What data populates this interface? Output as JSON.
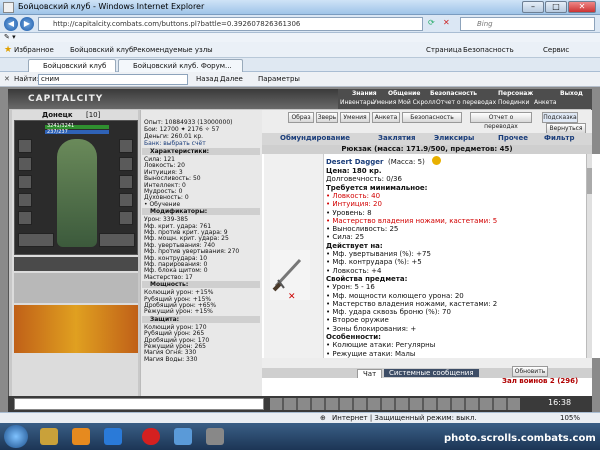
{
  "window": {
    "title": "Бойцовский клуб - Windows Internet Explorer",
    "url": "http://capitalcity.combats.com/buttons.pl?battle=0.392607826361306",
    "search_placeholder": "Bing",
    "menu": [
      "Страница",
      "Безопасность",
      "Сервис"
    ]
  },
  "favorites": {
    "label": "Избранное",
    "items": [
      "Бойцовский клуб",
      "Рекомендуемые узлы"
    ]
  },
  "tabs": [
    "Бойцовский клуб",
    "Бойцовский клуб. Форум..."
  ],
  "findbar": {
    "label": "Найти:",
    "value": "сним",
    "prev": "Назад",
    "next": "Далее",
    "params": "Параметры"
  },
  "game": {
    "logo": "CAPITALCITY",
    "topnav1": [
      "Знания",
      "Общение",
      "Безопасность",
      "Персонаж",
      "Выход"
    ],
    "topnav2": [
      "Инвентарь",
      "Умения",
      "Мой Скролл",
      "Отчет о переводах",
      "Поединки",
      "Анкета"
    ],
    "character": {
      "name": "Донецк",
      "level": "[10]",
      "hp": "3241/3241",
      "mana": "237/237"
    },
    "stats": {
      "lines": [
        "Опыт: 10884933 (13000000)",
        "Бои: 12700 ✦ 2176 ✧ 57",
        "Деньги: 260.01 кр.",
        "Банк: выбрать счёт"
      ],
      "sections": [
        {
          "title": "Характеристики:",
          "rows": [
            "Сила: 121",
            "Ловкость: 20",
            "Интуиция: 3",
            "Выносливость: 50",
            "Интеллект: 0",
            "Мудрость: 0",
            "Духовность: 0",
            "• Обучение"
          ]
        },
        {
          "title": "Модификаторы:",
          "rows": [
            "Урон: 339-385",
            "Мф. крит. удара: 761",
            "Мф. против крит. удара: 9",
            "Мф. мощн. крит. удара: 25",
            "Мф. увертывания: 740",
            "Мф. против увертывания: 270",
            "Мф. контрудара: 10",
            "Мф. парирования: 0",
            "Мф. блока щитом: 0",
            "Мастерство: 17"
          ]
        },
        {
          "title": "Мощность:",
          "rows": [
            "Колющий урон: +15%",
            "Рубящий урон: +15%",
            "Дробящий урон: +65%",
            "Режущий урон: +15%"
          ]
        },
        {
          "title": "Защита:",
          "rows": [
            "Колющий урон: 170",
            "Рубящий урон: 265",
            "Дробящий урон: 170",
            "Режущий урон: 265",
            "Магия Огня: 330",
            "Магия Воды: 330"
          ]
        }
      ]
    },
    "buttons": [
      "Образ",
      "Зверь",
      "Умения",
      "Анкета",
      "Безопасность",
      "Отчет о переводах",
      "Подсказка",
      "Вернуться"
    ],
    "inventory_tabs": [
      "Обмундирование",
      "Заклятия",
      "Эликсиры",
      "Прочее",
      "Фильтр"
    ],
    "backpack": "Рюкзак (масса: 171.9/500, предметов: 45)",
    "item": {
      "name": "Desert Dagger",
      "mass": "(Масса: 5)",
      "lines": [
        {
          "t": "Цена: 180 кр.",
          "c": "bold"
        },
        {
          "t": "Долговечность: 0/36",
          "c": ""
        },
        {
          "t": "Требуется минимальное:",
          "c": "bold"
        },
        {
          "t": "• Ловкость: 40",
          "c": "red"
        },
        {
          "t": "• Интуиция: 20",
          "c": "red"
        },
        {
          "t": "• Уровень: 8",
          "c": ""
        },
        {
          "t": "• Мастерство владения ножами, кастетами: 5",
          "c": "red"
        },
        {
          "t": "• Выносливость: 25",
          "c": ""
        },
        {
          "t": "• Сила: 25",
          "c": ""
        },
        {
          "t": "Действует на:",
          "c": "bold"
        },
        {
          "t": "• Мф. увертывания (%): +75",
          "c": ""
        },
        {
          "t": "• Мф. контрудара (%): +5",
          "c": ""
        },
        {
          "t": "• Ловкость: +4",
          "c": ""
        },
        {
          "t": "Свойства предмета:",
          "c": "bold"
        },
        {
          "t": "• Урон: 5 - 16",
          "c": ""
        },
        {
          "t": "• Мф. мощности колющего урона: 20",
          "c": ""
        },
        {
          "t": "• Мастерство владения ножами, кастетами: 2",
          "c": ""
        },
        {
          "t": "• Мф. удара сквозь броню (%): 70",
          "c": ""
        },
        {
          "t": "• Второе оружие",
          "c": ""
        },
        {
          "t": "• Зоны блокирования: +",
          "c": ""
        },
        {
          "t": "Особенности:",
          "c": "bold"
        },
        {
          "t": "• Колющие атаки: Регулярны",
          "c": ""
        },
        {
          "t": "• Режущие атаки: Малы",
          "c": ""
        }
      ]
    },
    "chat_tabs": [
      "Чат",
      "Системные сообщения"
    ],
    "refresh": "Обновить",
    "room": "Зал воинов 2 (296)",
    "clock": "16:38"
  },
  "statusbar": {
    "text": "Интернет | Защищенный режим: выкл.",
    "zoom": "105%"
  },
  "watermark": "photo.scrolls.combats.com"
}
